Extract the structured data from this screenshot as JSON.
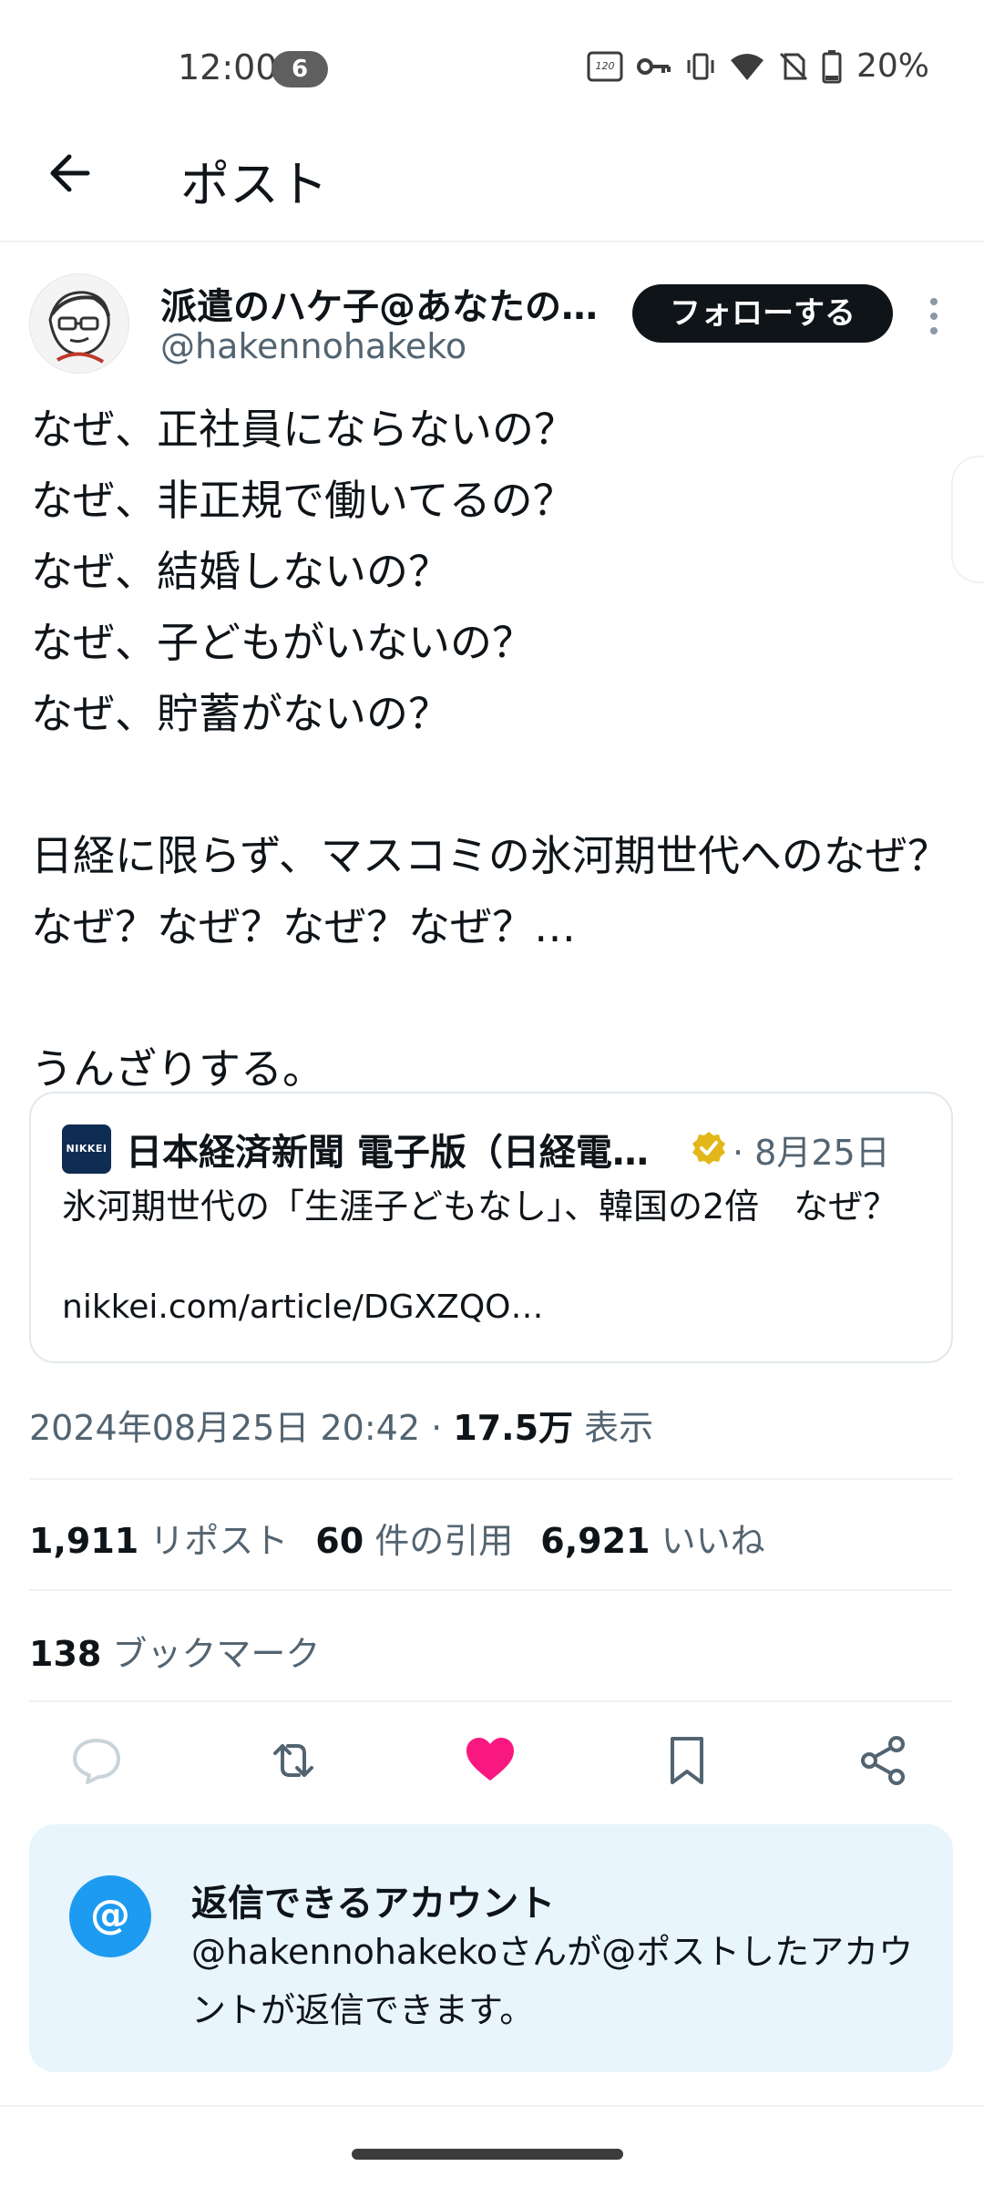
{
  "status_bar": {
    "time": "12:00",
    "notification_count": "6",
    "battery": "20%",
    "refresh_rate_label": "120",
    "icons": [
      "120hz-icon",
      "vpn-key-icon",
      "vibrate-icon",
      "wifi-icon",
      "no-sim-icon",
      "battery-icon"
    ]
  },
  "header": {
    "title": "ポスト"
  },
  "author": {
    "name": "派遣のハケ子@あなたの…",
    "handle": "@hakennohakeko",
    "follow_label": "フォローする"
  },
  "tweet": {
    "text": "なぜ、正社員にならないの？\nなぜ、非正規で働いてるの？\nなぜ、結婚しないの？\nなぜ、子どもがいないの？\nなぜ、貯蓄がないの？\n\n日経に限らず、マスコミの氷河期世代へのなぜ？なぜ？なぜ？なぜ？なぜ？…\n\nうんざりする。"
  },
  "quote": {
    "logo_text": "NIKKEI",
    "source_name": "日本経済新聞 電子版（日経電子…",
    "date": "· 8月25日",
    "text": "氷河期世代の「生涯子どもなし」、韓国の2倍　なぜ？",
    "link": "nikkei.com/article/DGXZQO…"
  },
  "meta": {
    "timestamp": "2024年08月25日 20:42 · ",
    "views_count": "17.5万",
    "views_label": " 表示"
  },
  "stats": {
    "reposts_count": "1,911",
    "reposts_label": " リポスト",
    "quotes_count": "60",
    "quotes_label": " 件の引用",
    "likes_count": "6,921",
    "likes_label": " いいね",
    "bookmarks_count": "138",
    "bookmarks_label": " ブックマーク"
  },
  "actions": {
    "like_color": "#f91880",
    "icon_color": "#536471"
  },
  "reply_settings": {
    "icon": "@",
    "title": "返信できるアカウント",
    "body": "@hakennohakekoさんが@ポストしたアカウントが返信できます。"
  }
}
